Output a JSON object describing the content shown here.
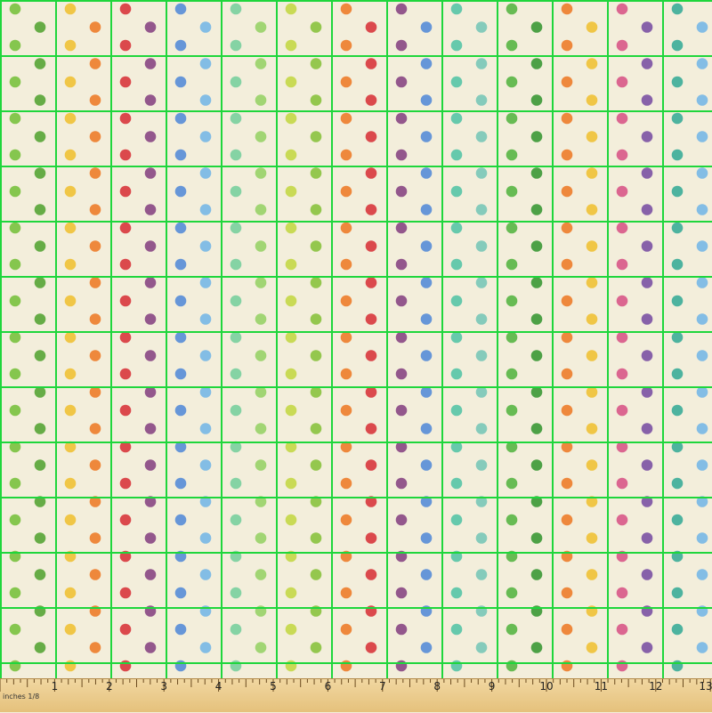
{
  "fabric": {
    "background_color": "#f3eedb",
    "grid_line_color": "#1fd63c",
    "columns": [
      {
        "dots": [
          "#7cc242",
          "#5aa63a"
        ]
      },
      {
        "dots": [
          "#f0c23a",
          "#ee7f2f"
        ]
      },
      {
        "dots": [
          "#d93b40",
          "#8b4a86"
        ]
      },
      {
        "dots": [
          "#5a8ed8",
          "#7ab8e6"
        ]
      },
      {
        "dots": [
          "#7cd0a0",
          "#9ad26a"
        ]
      },
      {
        "dots": [
          "#c6d84a",
          "#8cc342"
        ]
      },
      {
        "dots": [
          "#ee7f2f",
          "#d93b40"
        ]
      },
      {
        "dots": [
          "#8b4a86",
          "#5a8ed8"
        ]
      },
      {
        "dots": [
          "#5ac6a8",
          "#7cc8b8"
        ]
      },
      {
        "dots": [
          "#5bb648",
          "#3f9a3a"
        ]
      },
      {
        "dots": [
          "#ee7f2f",
          "#f0c23a"
        ]
      },
      {
        "dots": [
          "#d95a8a",
          "#7e55a5"
        ]
      },
      {
        "dots": [
          "#3fae9a",
          "#7ab8e6"
        ]
      }
    ]
  },
  "ruler": {
    "units_label": "inches 1/8",
    "labels": [
      "1",
      "2",
      "3",
      "4",
      "5",
      "6",
      "7",
      "8",
      "9",
      "10",
      "11",
      "12",
      "13"
    ]
  }
}
